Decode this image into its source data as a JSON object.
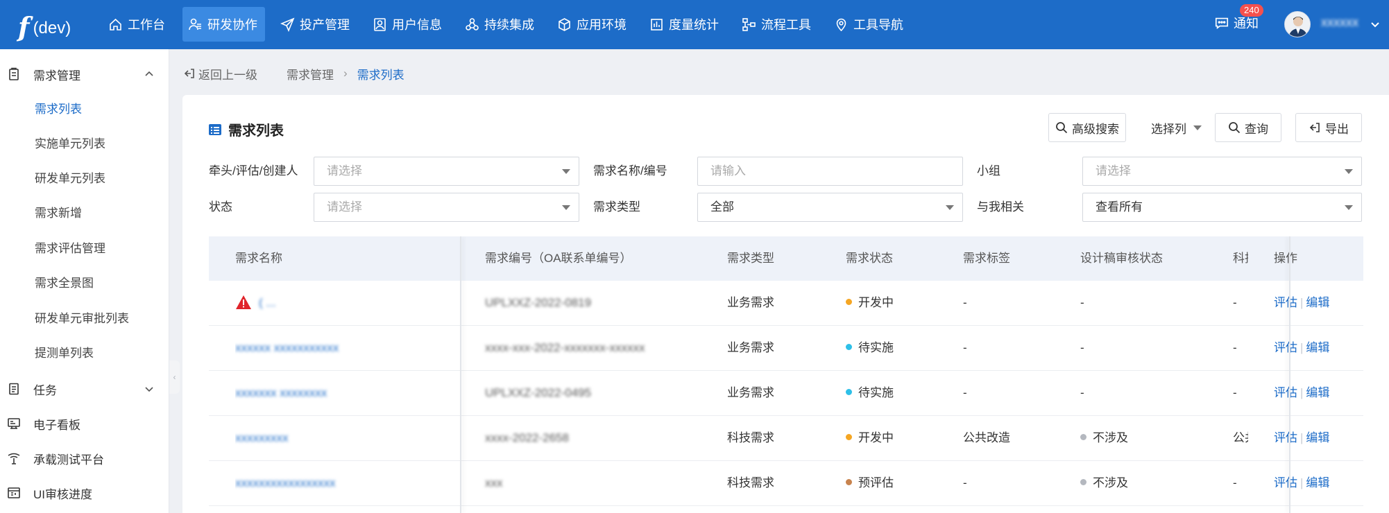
{
  "app": {
    "logo_main": "f",
    "logo_sup": "'",
    "logo_env": "(dev)"
  },
  "nav": [
    {
      "label": "工作台",
      "icon": "home-icon"
    },
    {
      "label": "研发协作",
      "icon": "user-collab-icon",
      "active": true
    },
    {
      "label": "投产管理",
      "icon": "send-icon"
    },
    {
      "label": "用户信息",
      "icon": "user-card-icon"
    },
    {
      "label": "持续集成",
      "icon": "integration-icon"
    },
    {
      "label": "应用环境",
      "icon": "cube-icon"
    },
    {
      "label": "度量统计",
      "icon": "bar-chart-icon"
    },
    {
      "label": "流程工具",
      "icon": "flow-icon"
    },
    {
      "label": "工具导航",
      "icon": "location-icon"
    }
  ],
  "header": {
    "notify_label": "通知",
    "notify_count": "240",
    "username": "xxxxxx"
  },
  "sidebar": {
    "groups": [
      {
        "label": "需求管理",
        "icon": "clipboard-icon",
        "expanded": true
      },
      {
        "label": "任务",
        "icon": "task-icon",
        "expanded": false
      },
      {
        "label": "电子看板",
        "icon": "kanban-icon"
      },
      {
        "label": "承载测试平台",
        "icon": "antenna-icon"
      },
      {
        "label": "UI审核进度",
        "icon": "ui-review-icon"
      }
    ],
    "items": [
      {
        "label": "需求列表",
        "active": true
      },
      {
        "label": "实施单元列表"
      },
      {
        "label": "研发单元列表"
      },
      {
        "label": "需求新增"
      },
      {
        "label": "需求评估管理"
      },
      {
        "label": "需求全景图"
      },
      {
        "label": "研发单元审批列表"
      },
      {
        "label": "提测单列表"
      }
    ]
  },
  "breadcrumb": {
    "back": "返回上一级",
    "parent": "需求管理",
    "current": "需求列表"
  },
  "card": {
    "title": "需求列表",
    "advanced_search": "高级搜索",
    "select_columns": "选择列",
    "query": "查询",
    "export": "导出"
  },
  "filters": {
    "owner_label": "牵头/评估/创建人",
    "owner_placeholder": "请选择",
    "name_label": "需求名称/编号",
    "name_placeholder": "请输入",
    "group_label": "小组",
    "group_placeholder": "请选择",
    "status_label": "状态",
    "status_placeholder": "请选择",
    "type_label": "需求类型",
    "type_value": "全部",
    "related_label": "与我相关",
    "related_value": "查看所有"
  },
  "table": {
    "headers": [
      "需求名称",
      "需求编号（OA联系单编号）",
      "需求类型",
      "需求状态",
      "需求标签",
      "设计稿审核状态",
      "科技",
      "操作"
    ],
    "op_evaluate": "评估",
    "op_edit": "编辑",
    "rows": [
      {
        "name": "( ...",
        "code": "UPLXXZ-2022-0819",
        "type": "业务需求",
        "status": "开发中",
        "status_color": "#f5a623",
        "tag": "-",
        "design": "-",
        "design_color": "",
        "tech": "-",
        "warning": true
      },
      {
        "name": "xxxxxx xxxxxxxxxxx",
        "code": "xxxx-xxx-2022-xxxxxxx-xxxxxx",
        "type": "业务需求",
        "status": "待实施",
        "status_color": "#2ec0e8",
        "tag": "-",
        "design": "-",
        "design_color": "",
        "tech": "-"
      },
      {
        "name": "xxxxxxx xxxxxxxx",
        "code": "UPLXXZ-2022-0495",
        "type": "业务需求",
        "status": "待实施",
        "status_color": "#2ec0e8",
        "tag": "-",
        "design": "-",
        "design_color": "",
        "tech": "-"
      },
      {
        "name": "xxxxxxxxx",
        "code": "xxxx-2022-2658",
        "type": "科技需求",
        "status": "开发中",
        "status_color": "#f5a623",
        "tag": "公共改造",
        "design": "不涉及",
        "design_color": "#b4b8bf",
        "tech": "公共"
      },
      {
        "name": "xxxxxxxxxxxxxxxxx",
        "code": "xxx",
        "type": "科技需求",
        "status": "预评估",
        "status_color": "#c8834e",
        "tag": "-",
        "design": "不涉及",
        "design_color": "#b4b8bf",
        "tech": "-"
      }
    ]
  },
  "colors": {
    "primary": "#1d6cc8",
    "topbar": "#1d6cc8",
    "active_nav": "#3b8ae2",
    "badge": "#f5504d",
    "danger": "#e0242b"
  }
}
